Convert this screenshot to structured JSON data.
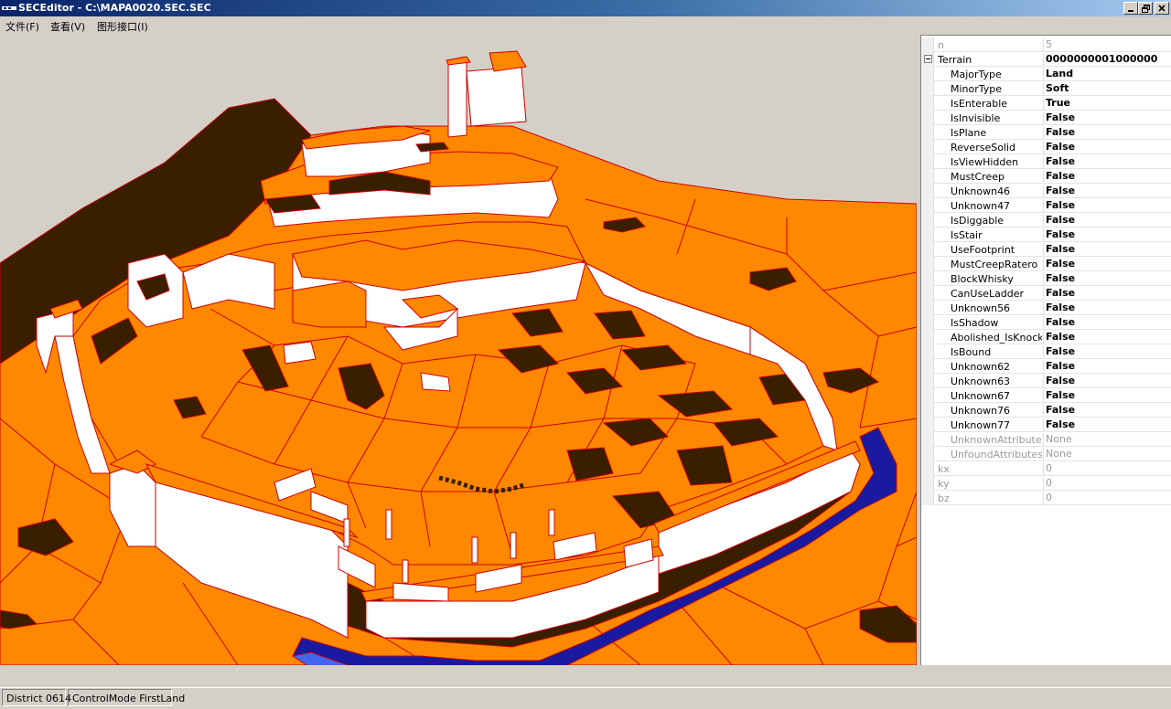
{
  "window": {
    "title": "SECEditor - C:\\MAPA0020.SEC.SEC"
  },
  "menu": {
    "items": [
      "文件(F)",
      "查看(V)",
      "图形接口(I)"
    ]
  },
  "properties": {
    "rows": [
      {
        "name": "n",
        "value": "5",
        "style": "grey",
        "level": 0
      },
      {
        "name": "Terrain",
        "value": "0000000001000000",
        "style": "bold",
        "level": 0,
        "expander": true
      },
      {
        "name": "MajorType",
        "value": "Land",
        "style": "bold",
        "level": 1
      },
      {
        "name": "MinorType",
        "value": "Soft",
        "style": "bold",
        "level": 1
      },
      {
        "name": "IsEnterable",
        "value": "True",
        "style": "bold",
        "level": 1
      },
      {
        "name": "IsInvisible",
        "value": "False",
        "style": "bold",
        "level": 1
      },
      {
        "name": "IsPlane",
        "value": "False",
        "style": "bold",
        "level": 1
      },
      {
        "name": "ReverseSolid",
        "value": "False",
        "style": "bold",
        "level": 1
      },
      {
        "name": "IsViewHidden",
        "value": "False",
        "style": "bold",
        "level": 1
      },
      {
        "name": "MustCreep",
        "value": "False",
        "style": "bold",
        "level": 1
      },
      {
        "name": "Unknown46",
        "value": "False",
        "style": "bold",
        "level": 1
      },
      {
        "name": "Unknown47",
        "value": "False",
        "style": "bold",
        "level": 1
      },
      {
        "name": "IsDiggable",
        "value": "False",
        "style": "bold",
        "level": 1
      },
      {
        "name": "IsStair",
        "value": "False",
        "style": "bold",
        "level": 1
      },
      {
        "name": "UseFootprint",
        "value": "False",
        "style": "bold",
        "level": 1
      },
      {
        "name": "MustCreepRatero",
        "value": "False",
        "style": "bold",
        "level": 1
      },
      {
        "name": "BlockWhisky",
        "value": "False",
        "style": "bold",
        "level": 1
      },
      {
        "name": "CanUseLadder",
        "value": "False",
        "style": "bold",
        "level": 1
      },
      {
        "name": "Unknown56",
        "value": "False",
        "style": "bold",
        "level": 1
      },
      {
        "name": "IsShadow",
        "value": "False",
        "style": "bold",
        "level": 1
      },
      {
        "name": "Abolished_IsKnocka",
        "value": "False",
        "style": "bold",
        "level": 1
      },
      {
        "name": "IsBound",
        "value": "False",
        "style": "bold",
        "level": 1
      },
      {
        "name": "Unknown62",
        "value": "False",
        "style": "bold",
        "level": 1
      },
      {
        "name": "Unknown63",
        "value": "False",
        "style": "bold",
        "level": 1
      },
      {
        "name": "Unknown67",
        "value": "False",
        "style": "bold",
        "level": 1
      },
      {
        "name": "Unknown76",
        "value": "False",
        "style": "bold",
        "level": 1
      },
      {
        "name": "Unknown77",
        "value": "False",
        "style": "bold",
        "level": 1
      },
      {
        "name": "UnknownAttributes",
        "value": "None",
        "style": "grey",
        "level": 1
      },
      {
        "name": "UnfoundAttributes",
        "value": "None",
        "style": "grey",
        "level": 1
      },
      {
        "name": "kx",
        "value": "0",
        "style": "grey",
        "level": 0
      },
      {
        "name": "ky",
        "value": "0",
        "style": "grey",
        "level": 0
      },
      {
        "name": "bz",
        "value": "0",
        "style": "grey",
        "level": 0
      }
    ]
  },
  "status": {
    "district": "District 0614",
    "control_mode": "ControlMode FirstLand"
  },
  "icons": {
    "app": "app-icon",
    "minimize": "minimize-icon",
    "maximize": "restore-icon",
    "close": "close-icon",
    "expander": "collapse-icon"
  },
  "colors": {
    "terrain_fill": "#ff8800",
    "terrain_edge": "#cc0000",
    "shadow": "#3a1e00",
    "wall": "#ffffff",
    "water": "#1a1aa0",
    "titlebar": "#0a246a"
  }
}
